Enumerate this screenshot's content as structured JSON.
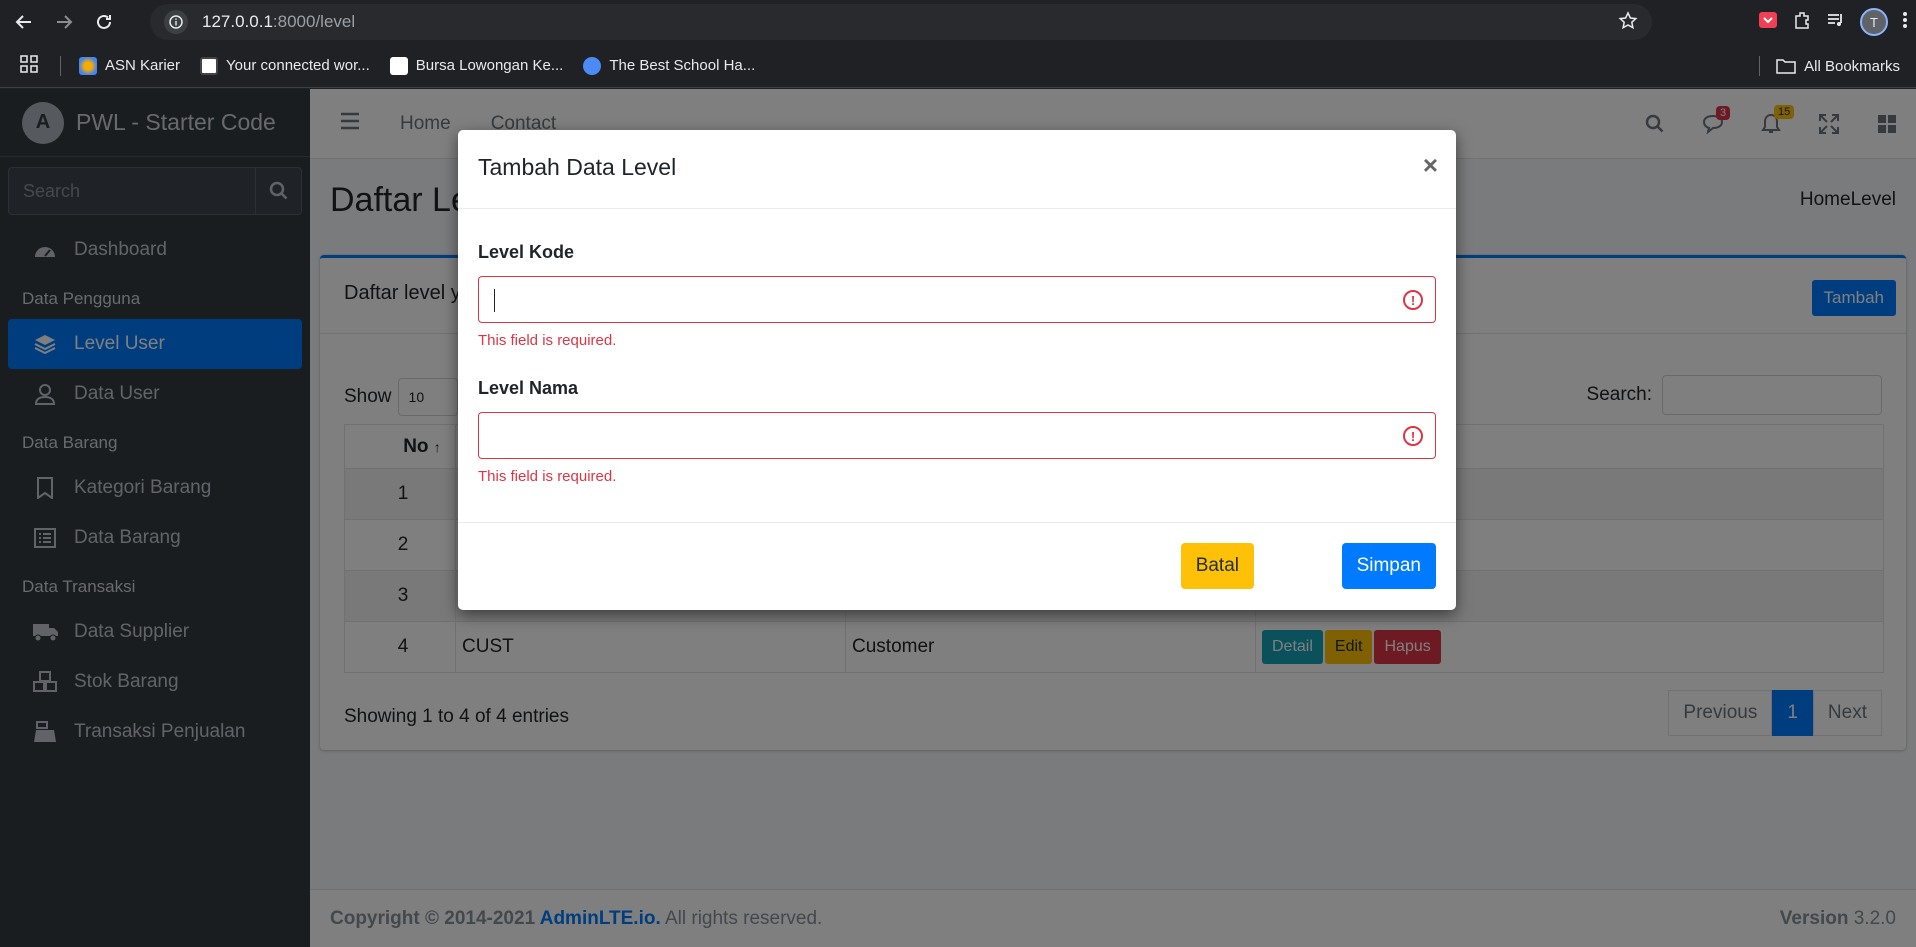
{
  "browser": {
    "url_host": "127.0.0.1",
    "url_path": ":8000/level",
    "profile_initial": "T",
    "bookmarks": [
      "ASN Karier",
      "Your connected wor...",
      "Bursa Lowongan Ke...",
      "The Best School Ha..."
    ],
    "all_bookmarks": "All Bookmarks"
  },
  "sidebar": {
    "brand": "PWL - Starter Code",
    "search_placeholder": "Search",
    "dashboard": "Dashboard",
    "header_pengguna": "Data Pengguna",
    "level_user": "Level User",
    "data_user": "Data User",
    "header_barang": "Data Barang",
    "kategori_barang": "Kategori Barang",
    "data_barang": "Data Barang",
    "header_transaksi": "Data Transaksi",
    "data_supplier": "Data Supplier",
    "stok_barang": "Stok Barang",
    "transaksi_penjualan": "Transaksi Penjualan"
  },
  "topnav": {
    "home": "Home",
    "contact": "Contact",
    "messages_count": "3",
    "notifications_count": "15"
  },
  "page": {
    "title": "Daftar Level",
    "breadcrumb": "HomeLevel",
    "card_title": "Daftar level yang terdaftar dalam sistem",
    "tambah": "Tambah"
  },
  "datatable": {
    "show_label": "Show",
    "show_value": "10",
    "search_label": "Search:",
    "header_no": "No",
    "rows": [
      {
        "no": "1",
        "kode": "",
        "nama": ""
      },
      {
        "no": "2",
        "kode": "",
        "nama": ""
      },
      {
        "no": "3",
        "kode": "",
        "nama": ""
      },
      {
        "no": "4",
        "kode": "CUST",
        "nama": "Customer"
      }
    ],
    "detail": "Detail",
    "edit": "Edit",
    "hapus": "Hapus",
    "info": "Showing 1 to 4 of 4 entries",
    "previous": "Previous",
    "current_page": "1",
    "next": "Next"
  },
  "footer": {
    "copyright": "Copyright © 2014-2021 ",
    "link": "AdminLTE.io.",
    "rights": " All rights reserved.",
    "version_label": "Version",
    "version": "3.2.0"
  },
  "modal": {
    "title": "Tambah Data Level",
    "close": "×",
    "field1_label": "Level Kode",
    "field1_error": "This field is required.",
    "field2_label": "Level Nama",
    "field2_error": "This field is required.",
    "batal": "Batal",
    "simpan": "Simpan"
  }
}
